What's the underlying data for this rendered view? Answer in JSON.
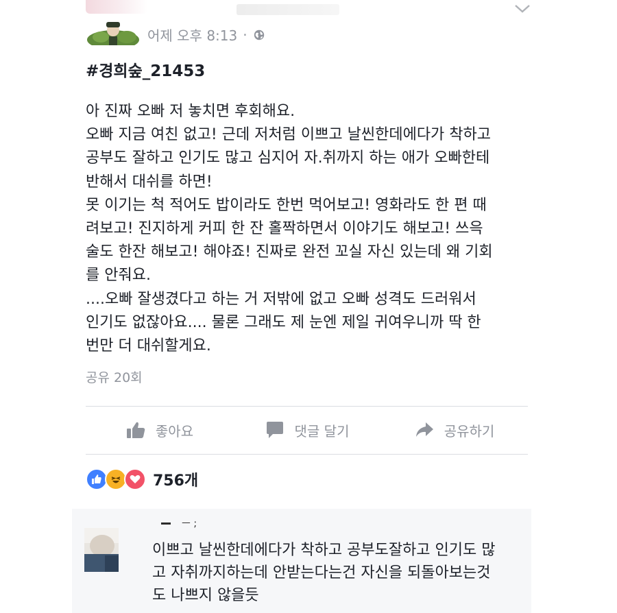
{
  "post": {
    "timestamp": "어제 오후 8:13",
    "dot": "·",
    "hashtag": "#경희숲_21453",
    "body_lines": [
      "아 진짜 오빠 저 놓치면 후회해요.",
      "오빠 지금 여친 없고! 근데 저처럼 이쁘고 날씬한데에다가 착하고",
      "공부도 잘하고 인기도 많고 심지어 자.취까지 하는 애가 오빠한테",
      "반해서 대쉬를 하면!",
      "못 이기는 척 적어도 밥이라도 한번 먹어보고! 영화라도 한 편 때",
      "려보고! 진지하게 커피 한 잔 홀짝하면서 이야기도 해보고! 쓰윽",
      "술도 한잔 해보고! 해야죠! 진짜로 완전 꼬실 자신 있는데 왜 기회",
      "를 안줘요.",
      "....오빠 잘생겼다고 하는 거 저밖에 없고 오빠 성격도 드러워서",
      "인기도 없잖아요.... 물론 그래도 제 눈엔 제일 귀여우니까 딱 한",
      "번만 더 대쉬할게요."
    ],
    "shares": "공유 20회"
  },
  "actions": {
    "like": "좋아요",
    "comment": "댓글 달기",
    "share": "공유하기"
  },
  "reactions": {
    "count": "756개",
    "icons": [
      "like-icon",
      "haha-icon",
      "love-icon"
    ]
  },
  "comment": {
    "name_fragment": "ㅡ ;",
    "lines": [
      "이쁘고 날씬한데에다가 착하고 공부도잘하고 인기도 많",
      "고 자취까지하는데 안받는다는건 자신을 되돌아보는것",
      "도 나쁘지 않을듯"
    ]
  },
  "colors": {
    "text": "#1d2129",
    "meta": "#90949c",
    "like_blue": "#4080ff",
    "haha_yellow": "#f7b125",
    "love_red": "#f25268",
    "separator": "#dadde1"
  }
}
